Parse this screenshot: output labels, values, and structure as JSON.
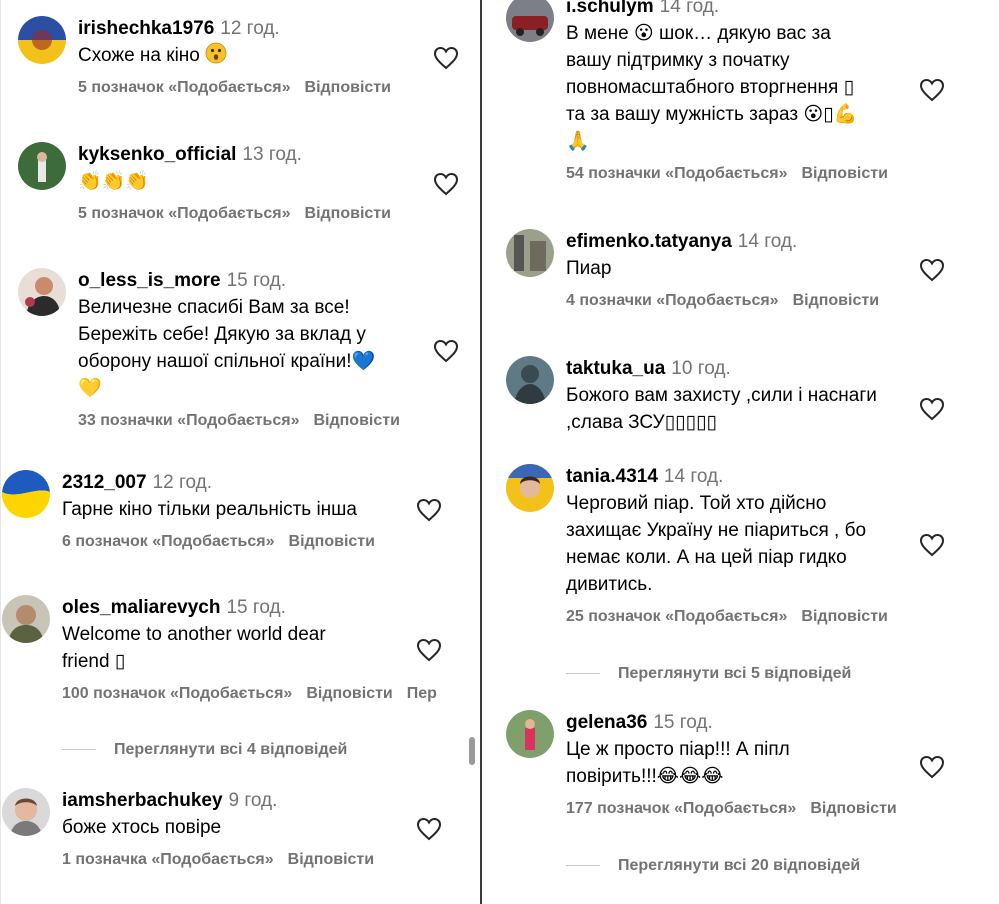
{
  "left": {
    "comments": [
      {
        "user": "irishechka1976",
        "time": "12 год.",
        "text": [
          "Схоже на кіно 😮"
        ],
        "likes": "5 позначок «Подобається»",
        "reply": "Відповісти"
      },
      {
        "user": "kyksenko_official",
        "time": "13 год.",
        "text": [
          "👏👏👏"
        ],
        "likes": "5 позначок «Подобається»",
        "reply": "Відповісти"
      },
      {
        "user": "o_less_is_more",
        "time": "15 год.",
        "text": [
          "Величезне спасибі Вам за все!",
          "Бережіть себе! Дякую за вклад у",
          "оборону нашої спільної країни!💙",
          "💛"
        ],
        "likes": "33 позначки «Подобається»",
        "reply": "Відповісти"
      },
      {
        "user": "2312_007",
        "time": "12 год.",
        "text": [
          "Гарне кіно тільки реальність інша"
        ],
        "likes": "6 позначок «Подобається»",
        "reply": "Відповісти"
      },
      {
        "user": "oles_maliarevych",
        "time": "15 год.",
        "text": [
          "Welcome to another world dear",
          "friend ▯"
        ],
        "likes": "100 позначок «Подобається»",
        "reply": "Відповісти",
        "extra": "Пер"
      },
      {
        "user": "iamsherbachukey",
        "time": "9 год.",
        "text": [
          "боже хтось повіре"
        ],
        "likes": "1 позначка «Подобається»",
        "reply": "Відповісти"
      }
    ],
    "view_replies": "Переглянути всі 4 відповідей"
  },
  "right": {
    "comments": [
      {
        "user": "i.schulym",
        "time": "14 год.",
        "text": [
          "В мене 😮 шок… дякую вас за",
          "вашу підтримку з початку",
          "повномасштабного вторгнення ▯",
          "та за вашу мужність зараз 😮▯💪",
          "🙏"
        ],
        "likes": "54 позначки «Подобається»",
        "reply": "Відповісти"
      },
      {
        "user": "efimenko.tatyanya",
        "time": "14 год.",
        "text": [
          "Пиар"
        ],
        "likes": "4 позначки «Подобається»",
        "reply": "Відповісти"
      },
      {
        "user": "taktuka_ua",
        "time": "10 год.",
        "text": [
          "Божого вам захисту ,сили і наснаги",
          ",слава ЗСУ▯▯▯▯▯"
        ],
        "likes": "",
        "reply": ""
      },
      {
        "user": "tania.4314",
        "time": "14 год.",
        "text": [
          "Черговий піар. Той хто дійсно",
          "захищає Україну не піариться , бо",
          "немає коли. А на цей піар гидко",
          "дивитись."
        ],
        "likes": "25 позначок «Подобається»",
        "reply": "Відповісти"
      },
      {
        "user": "gelena36",
        "time": "15 год.",
        "text": [
          "Це ж просто піар!!! А піпл",
          "повірить!!!😂😂😂"
        ],
        "likes": "177 позначок «Подобається»",
        "reply": "Відповісти"
      }
    ],
    "view_replies_1": "Переглянути всі 5 відповідей",
    "view_replies_2": "Переглянути всі 20 відповідей"
  },
  "colors": {
    "text": "#000000",
    "muted": "#737373",
    "divider": "#c7c7c7",
    "scrollbar": "#9a9a9a"
  },
  "icons": {
    "like": "heart-outline-icon"
  }
}
